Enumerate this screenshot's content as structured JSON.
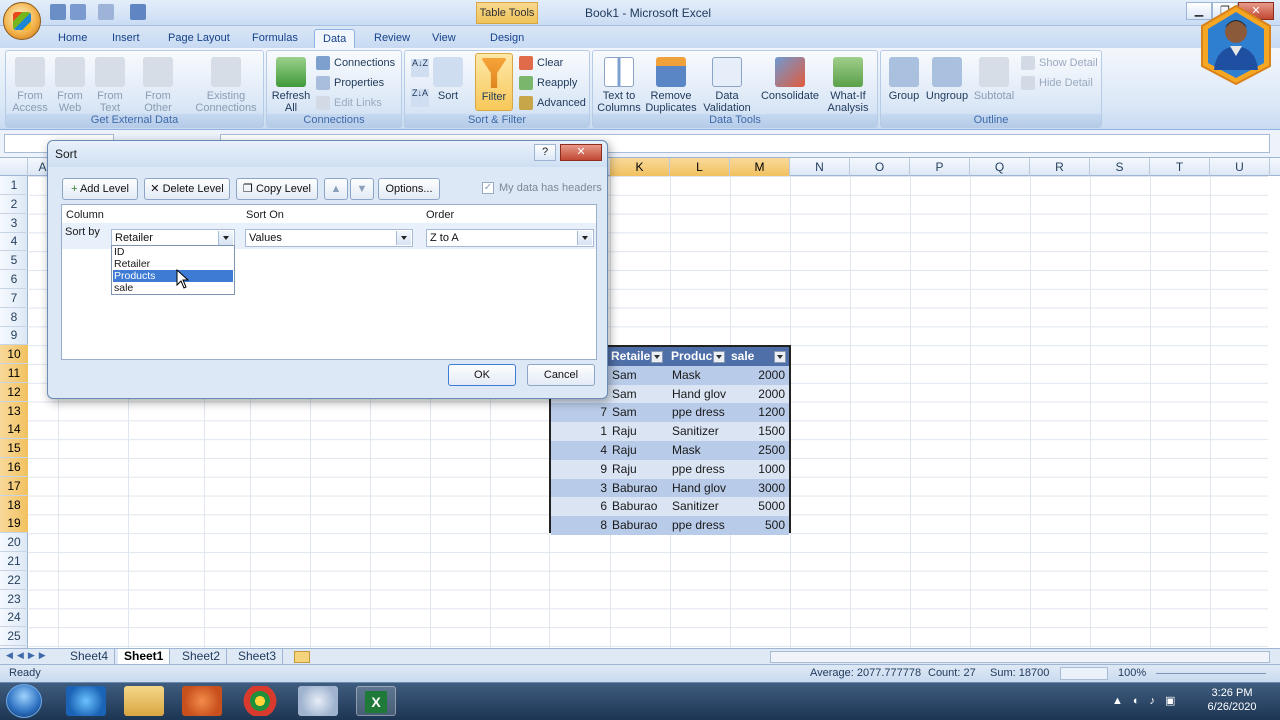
{
  "app": {
    "window_title": "Book1 - Microsoft Excel",
    "contextual_tab": "Table Tools"
  },
  "tabs": [
    {
      "label": "Home"
    },
    {
      "label": "Insert"
    },
    {
      "label": "Page Layout"
    },
    {
      "label": "Formulas"
    },
    {
      "label": "Data"
    },
    {
      "label": "Review"
    },
    {
      "label": "View"
    },
    {
      "label": "Design"
    }
  ],
  "ribbon": {
    "get_external": {
      "label": "Get External Data",
      "buttons": [
        "From Access",
        "From Web",
        "From Text",
        "From Other Sources",
        "Existing Connections"
      ]
    },
    "connections": {
      "label": "Connections",
      "refresh": "Refresh All",
      "connections": "Connections",
      "properties": "Properties",
      "edit_links": "Edit Links"
    },
    "sort_filter": {
      "label": "Sort & Filter",
      "sort": "Sort",
      "filter": "Filter",
      "clear": "Clear",
      "reapply": "Reapply",
      "advanced": "Advanced"
    },
    "data_tools": {
      "label": "Data Tools",
      "buttons": [
        "Text to Columns",
        "Remove Duplicates",
        "Data Validation",
        "Consolidate",
        "What-If Analysis"
      ]
    },
    "outline": {
      "label": "Outline",
      "group": "Group",
      "ungroup": "Ungroup",
      "subtotal": "Subtotal",
      "show_detail": "Show Detail",
      "hide_detail": "Hide Detail"
    }
  },
  "columns": [
    "K",
    "L",
    "M",
    "N",
    "O",
    "P",
    "Q",
    "R",
    "S",
    "T",
    "U"
  ],
  "col_a": "A",
  "rows": [
    "1",
    "2",
    "3",
    "4",
    "5",
    "6",
    "7",
    "8",
    "9",
    "10",
    "11",
    "12",
    "13",
    "14",
    "15",
    "16",
    "17",
    "18",
    "19",
    "20",
    "21",
    "22",
    "23",
    "24",
    "25"
  ],
  "table": {
    "headers": [
      "Retaile",
      "Produc",
      "sale"
    ],
    "rows": [
      {
        "id": "",
        "retailer": "Sam",
        "product": "Mask",
        "sale": "2000"
      },
      {
        "id": "",
        "retailer": "Sam",
        "product": "Hand glov",
        "sale": "2000"
      },
      {
        "id": "7",
        "retailer": "Sam",
        "product": "ppe dress",
        "sale": "1200"
      },
      {
        "id": "1",
        "retailer": "Raju",
        "product": "Sanitizer",
        "sale": "1500"
      },
      {
        "id": "4",
        "retailer": "Raju",
        "product": "Mask",
        "sale": "2500"
      },
      {
        "id": "9",
        "retailer": "Raju",
        "product": "ppe dress",
        "sale": "1000"
      },
      {
        "id": "3",
        "retailer": "Baburao",
        "product": "Hand glov",
        "sale": "3000"
      },
      {
        "id": "6",
        "retailer": "Baburao",
        "product": "Sanitizer",
        "sale": "5000"
      },
      {
        "id": "8",
        "retailer": "Baburao",
        "product": "ppe dress",
        "sale": "500"
      }
    ]
  },
  "dialog": {
    "title": "Sort",
    "help": "?",
    "add_level": "Add Level",
    "delete_level": "Delete Level",
    "copy_level": "Copy Level",
    "options": "Options...",
    "headers_checkbox": "My data has headers",
    "col_header": "Column",
    "sort_on_header": "Sort On",
    "order_header": "Order",
    "sort_by": "Sort by",
    "column_value": "Retailer",
    "sort_on_value": "Values",
    "order_value": "Z to A",
    "column_options": [
      "ID",
      "Retailer",
      "Products",
      "sale"
    ],
    "ok": "OK",
    "cancel": "Cancel"
  },
  "sheets": [
    "Sheet4",
    "Sheet1",
    "Sheet2",
    "Sheet3"
  ],
  "status": {
    "ready": "Ready",
    "average": "Average: 2077.777778",
    "count": "Count: 27",
    "sum": "Sum: 18700",
    "zoom": "100%"
  },
  "clock": {
    "time": "3:26 PM",
    "date": "6/26/2020"
  }
}
